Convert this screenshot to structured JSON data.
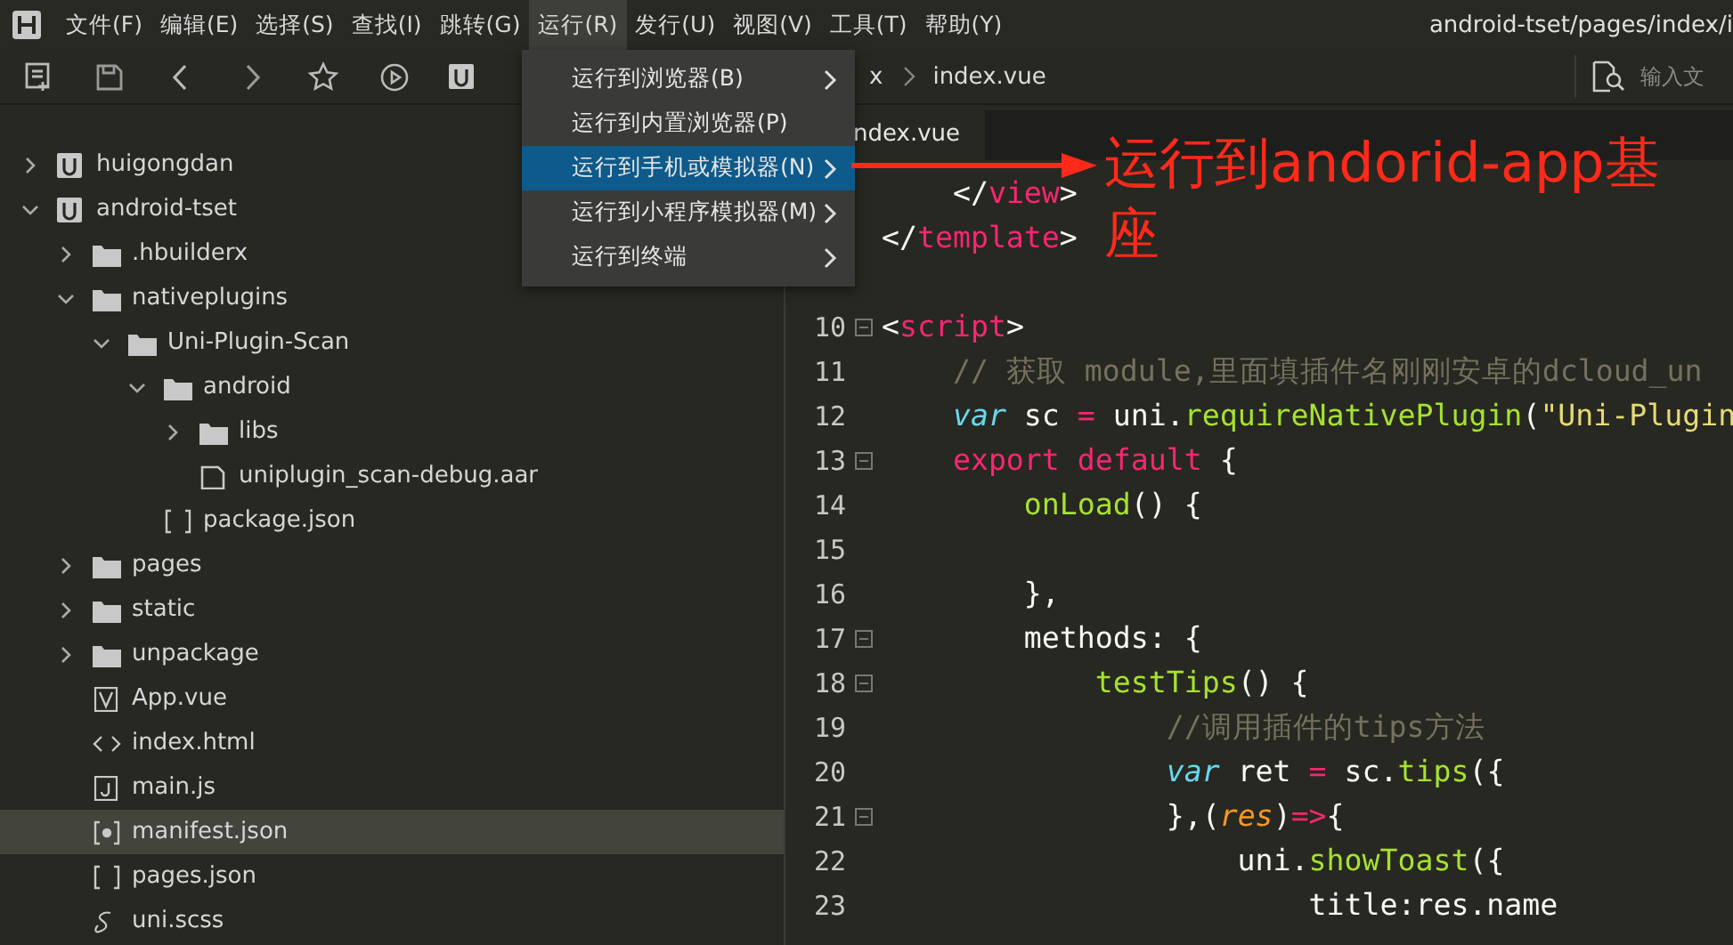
{
  "menubar": {
    "items": [
      {
        "label": "文件(F)",
        "selected": false
      },
      {
        "label": "编辑(E)",
        "selected": false
      },
      {
        "label": "选择(S)",
        "selected": false
      },
      {
        "label": "查找(I)",
        "selected": false
      },
      {
        "label": "跳转(G)",
        "selected": false
      },
      {
        "label": "运行(R)",
        "selected": true
      },
      {
        "label": "发行(U)",
        "selected": false
      },
      {
        "label": "视图(V)",
        "selected": false
      },
      {
        "label": "工具(T)",
        "selected": false
      },
      {
        "label": "帮助(Y)",
        "selected": false
      }
    ],
    "path": "android-tset/pages/index/i"
  },
  "toolbar": {
    "breadcrumb": [
      "x",
      "index.vue"
    ],
    "search": {
      "placeholder": "输入文"
    }
  },
  "run_menu": [
    {
      "label": "运行到浏览器(B)",
      "submenu": true,
      "selected": false
    },
    {
      "label": "运行到内置浏览器(P)",
      "submenu": false,
      "selected": false
    },
    {
      "label": "运行到手机或模拟器(N)",
      "submenu": true,
      "selected": true
    },
    {
      "label": "运行到小程序模拟器(M)",
      "submenu": true,
      "selected": false
    },
    {
      "label": "运行到终端",
      "submenu": true,
      "selected": false
    }
  ],
  "sidebar": {
    "tree": [
      {
        "label": "huigongdan",
        "kind": "project",
        "expanded": false,
        "selected": false
      },
      {
        "label": "android-tset",
        "kind": "project",
        "expanded": true,
        "selected": false,
        "children": [
          {
            "label": ".hbuilderx",
            "kind": "folder",
            "expanded": false,
            "selected": false
          },
          {
            "label": "nativeplugins",
            "kind": "folder",
            "expanded": true,
            "selected": false,
            "children": [
              {
                "label": "Uni-Plugin-Scan",
                "kind": "folder",
                "expanded": true,
                "selected": false,
                "children": [
                  {
                    "label": "android",
                    "kind": "folder",
                    "expanded": true,
                    "selected": false,
                    "children": [
                      {
                        "label": "libs",
                        "kind": "folder",
                        "expanded": false,
                        "selected": false
                      },
                      {
                        "label": "uniplugin_scan-debug.aar",
                        "kind": "file",
                        "selected": false
                      }
                    ]
                  },
                  {
                    "label": "package.json",
                    "kind": "json",
                    "selected": false
                  }
                ]
              }
            ]
          },
          {
            "label": "pages",
            "kind": "folder",
            "expanded": false,
            "selected": false
          },
          {
            "label": "static",
            "kind": "folder",
            "expanded": false,
            "selected": false
          },
          {
            "label": "unpackage",
            "kind": "folder",
            "expanded": false,
            "selected": false
          },
          {
            "label": "App.vue",
            "kind": "vue",
            "selected": false
          },
          {
            "label": "index.html",
            "kind": "html",
            "selected": false
          },
          {
            "label": "main.js",
            "kind": "js",
            "selected": false
          },
          {
            "label": "manifest.json",
            "kind": "manifest",
            "selected": true
          },
          {
            "label": "pages.json",
            "kind": "json",
            "selected": false
          },
          {
            "label": "uni.scss",
            "kind": "scss",
            "selected": false
          }
        ]
      }
    ]
  },
  "editor": {
    "tab": {
      "label": "ndex.vue",
      "selected": true
    },
    "top_lines": [
      {
        "tokens": [
          {
            "text": "    </",
            "kind": "plain"
          },
          {
            "text": "view",
            "kind": "tag"
          },
          {
            "text": ">",
            "kind": "plain"
          }
        ]
      },
      {
        "tokens": [
          {
            "text": "</",
            "kind": "plain"
          },
          {
            "text": "template",
            "kind": "tag"
          },
          {
            "text": ">",
            "kind": "plain"
          }
        ]
      }
    ],
    "lines": [
      {
        "number": "10",
        "fold": true,
        "tokens": [
          {
            "text": "<",
            "kind": "plain"
          },
          {
            "text": "script",
            "kind": "tag"
          },
          {
            "text": ">",
            "kind": "plain"
          }
        ]
      },
      {
        "number": "11",
        "tokens": [
          {
            "text": "    // 获取 module,里面填插件名刚刚安卓的dcloud_un",
            "kind": "comment"
          }
        ]
      },
      {
        "number": "12",
        "tokens": [
          {
            "text": "    var",
            "kind": "keyword"
          },
          {
            "text": " sc ",
            "kind": "plain"
          },
          {
            "text": "=",
            "kind": "op"
          },
          {
            "text": " uni.",
            "kind": "plain"
          },
          {
            "text": "requireNativePlugin",
            "kind": "func"
          },
          {
            "text": "(",
            "kind": "plain"
          },
          {
            "text": "\"Uni-Plugin",
            "kind": "string"
          }
        ]
      },
      {
        "number": "13",
        "fold": true,
        "tokens": [
          {
            "text": "    export default",
            "kind": "tag"
          },
          {
            "text": " {",
            "kind": "plain"
          }
        ]
      },
      {
        "number": "14",
        "tokens": [
          {
            "text": "        onLoad",
            "kind": "func"
          },
          {
            "text": "() {",
            "kind": "plain"
          }
        ]
      },
      {
        "number": "15"
      },
      {
        "number": "16",
        "tokens": [
          {
            "text": "        },",
            "kind": "plain"
          }
        ]
      },
      {
        "number": "17",
        "fold": true,
        "tokens": [
          {
            "text": "        methods: {",
            "kind": "plain"
          }
        ]
      },
      {
        "number": "18",
        "fold": true,
        "tokens": [
          {
            "text": "            testTips",
            "kind": "func"
          },
          {
            "text": "() {",
            "kind": "plain"
          }
        ]
      },
      {
        "number": "19",
        "tokens": [
          {
            "text": "                //调用插件的tips方法",
            "kind": "comment"
          }
        ]
      },
      {
        "number": "20",
        "tokens": [
          {
            "text": "                var",
            "kind": "keyword"
          },
          {
            "text": " ret ",
            "kind": "plain"
          },
          {
            "text": "=",
            "kind": "op"
          },
          {
            "text": " sc.",
            "kind": "plain"
          },
          {
            "text": "tips",
            "kind": "func"
          },
          {
            "text": "({",
            "kind": "plain"
          }
        ]
      },
      {
        "number": "21",
        "fold": true,
        "tokens": [
          {
            "text": "                },(",
            "kind": "plain"
          },
          {
            "text": "res",
            "kind": "param"
          },
          {
            "text": ")",
            "kind": "plain"
          },
          {
            "text": "=>",
            "kind": "op"
          },
          {
            "text": "{",
            "kind": "plain"
          }
        ]
      },
      {
        "number": "22",
        "tokens": [
          {
            "text": "                    uni.",
            "kind": "plain"
          },
          {
            "text": "showToast",
            "kind": "func"
          },
          {
            "text": "({",
            "kind": "plain"
          }
        ]
      },
      {
        "number": "23",
        "tokens": [
          {
            "text": "                        title:res.name",
            "kind": "plain"
          }
        ]
      }
    ]
  },
  "annotation": {
    "text": "运行到andorid-app基座"
  }
}
